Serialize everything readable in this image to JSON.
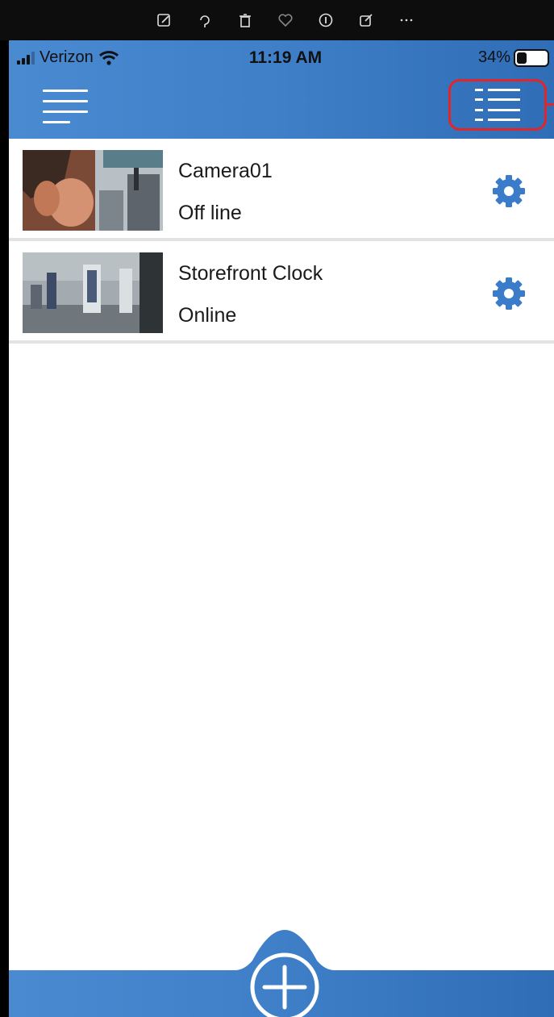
{
  "viewer_toolbar": {
    "icons": [
      "edit-icon",
      "rotate-icon",
      "trash-icon",
      "heart-icon",
      "info-icon",
      "share-icon",
      "more-icon"
    ]
  },
  "status_bar": {
    "carrier": "Verizon",
    "time": "11:19 AM",
    "battery": "34%",
    "battery_level": 0.34
  },
  "app_bar": {
    "menu_icon": "hamburger-menu-icon",
    "list_view_icon": "list-view-icon",
    "highlight_color": "#e0262a"
  },
  "cameras": [
    {
      "name": "Camera01",
      "status": "Off line"
    },
    {
      "name": "Storefront Clock",
      "status": "Online"
    }
  ],
  "colors": {
    "brand_blue": "#3f7fc8",
    "gear_blue": "#3a7cc9",
    "divider": "#e3e3e3"
  },
  "bottom_bar": {
    "add_icon": "plus-circle-icon"
  }
}
